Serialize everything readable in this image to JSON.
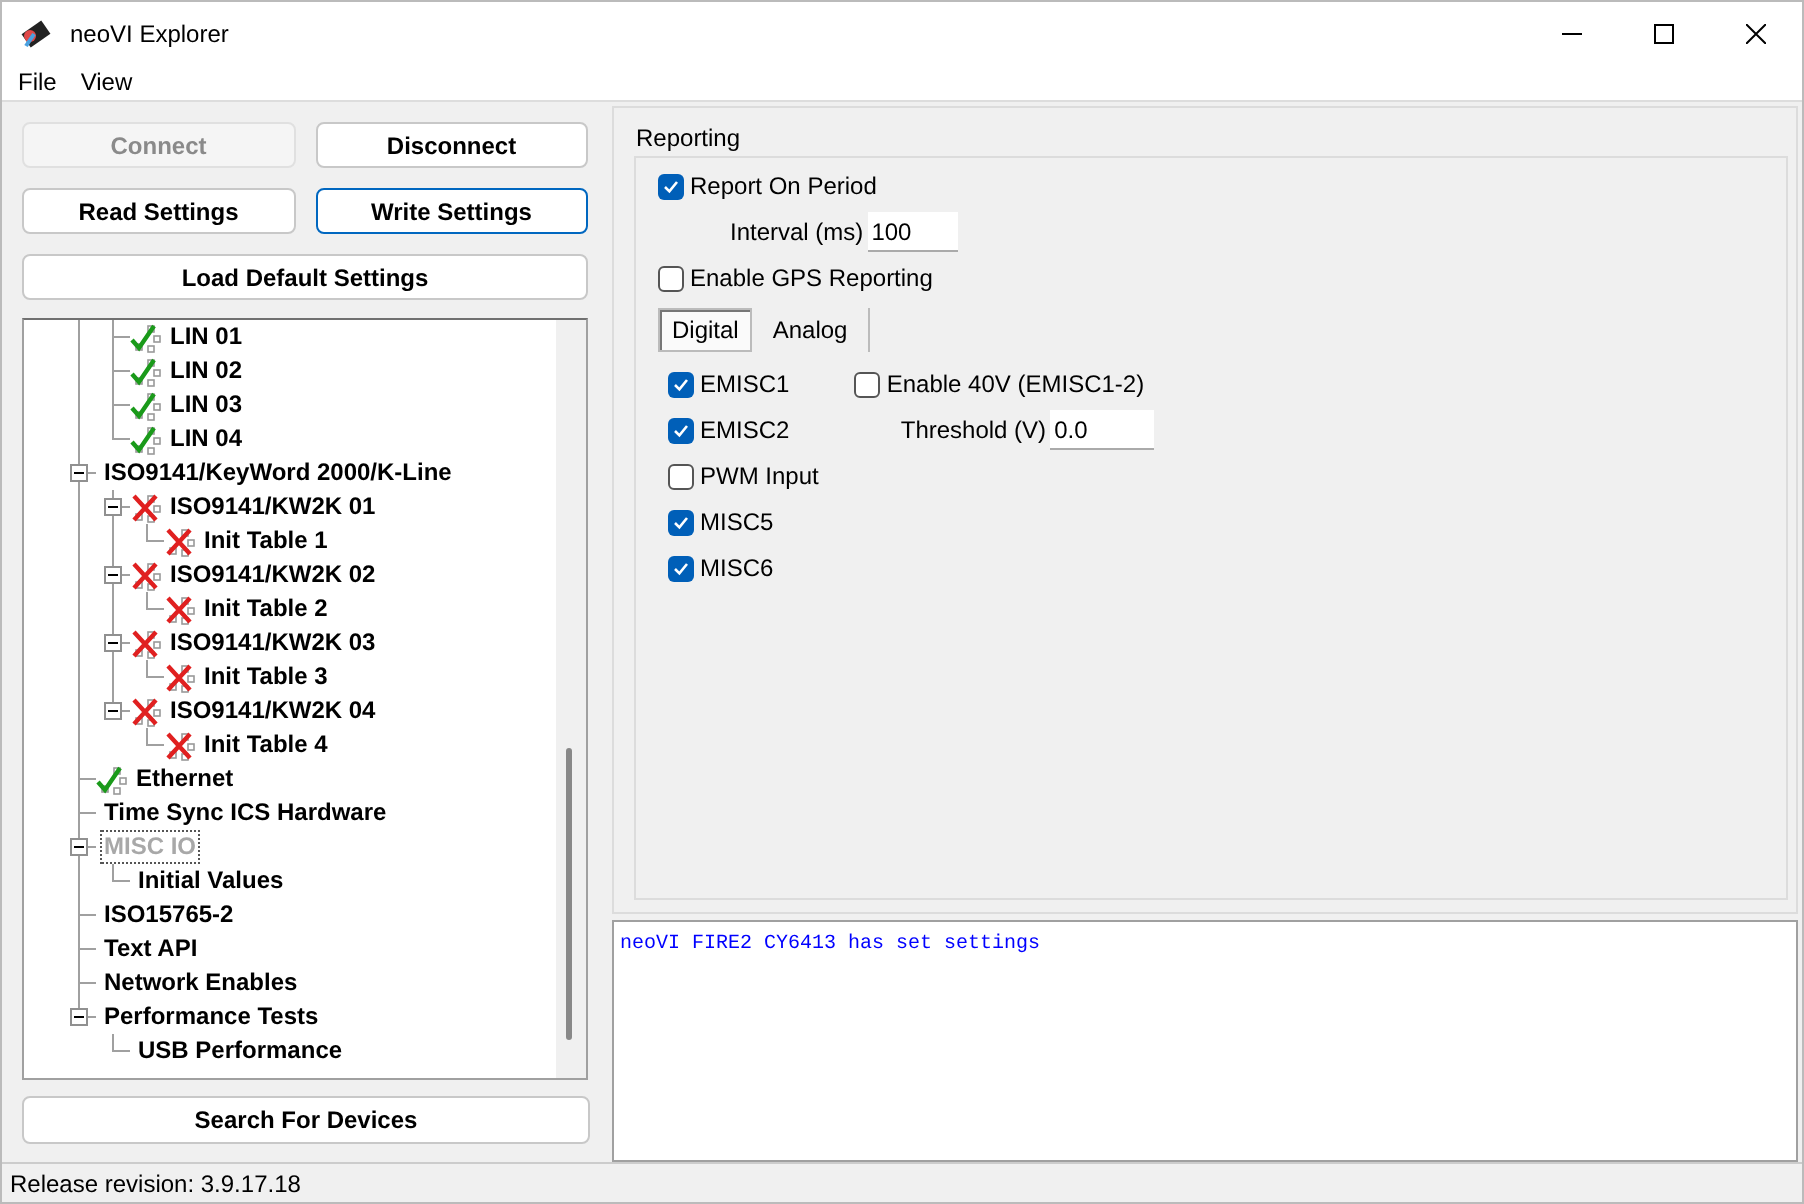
{
  "window": {
    "title": "neoVI Explorer"
  },
  "menu": [
    "File",
    "View"
  ],
  "buttons": [
    {
      "label": "Connect",
      "disabled": true,
      "focused": false
    },
    {
      "label": "Disconnect",
      "disabled": false,
      "focused": false
    },
    {
      "label": "Read Settings",
      "disabled": false,
      "focused": false
    },
    {
      "label": "Write Settings",
      "disabled": false,
      "focused": true
    },
    {
      "label": "Load Default Settings",
      "disabled": false,
      "focused": false
    }
  ],
  "tree": [
    {
      "children": [
        {
          "label": "LIN 01",
          "kind": "ok"
        },
        {
          "label": "LIN 02",
          "kind": "ok"
        },
        {
          "label": "LIN 03",
          "kind": "ok"
        },
        {
          "label": "LIN 04",
          "kind": "ok"
        }
      ]
    },
    {
      "label": "ISO9141/KeyWord 2000/K-Line",
      "expanded": true,
      "children": [
        {
          "label": "ISO9141/KW2K 01",
          "kind": "error",
          "expanded": true,
          "children": [
            {
              "label": "Init Table 1",
              "kind": "error"
            }
          ]
        },
        {
          "label": "ISO9141/KW2K 02",
          "kind": "error",
          "expanded": true,
          "children": [
            {
              "label": "Init Table 2",
              "kind": "error"
            }
          ]
        },
        {
          "label": "ISO9141/KW2K 03",
          "kind": "error",
          "expanded": true,
          "children": [
            {
              "label": "Init Table 3",
              "kind": "error"
            }
          ]
        },
        {
          "label": "ISO9141/KW2K 04",
          "kind": "error",
          "expanded": true,
          "children": [
            {
              "label": "Init Table 4",
              "kind": "error"
            }
          ]
        }
      ]
    },
    {
      "label": "Ethernet",
      "kind": "ok"
    },
    {
      "label": "Time Sync ICS Hardware"
    },
    {
      "label": "MISC IO",
      "disabled": true,
      "selected": true,
      "expanded": true,
      "children": [
        {
          "label": "Initial Values"
        }
      ]
    },
    {
      "label": "ISO15765-2"
    },
    {
      "label": "Text API"
    },
    {
      "label": "Network Enables"
    },
    {
      "label": "Performance Tests",
      "expanded": true,
      "children": [
        {
          "label": "USB Performance"
        }
      ]
    }
  ],
  "search_button": {
    "label": "Search For Devices"
  },
  "reporting": {
    "title": "Reporting",
    "report_on_period": {
      "label": "Report On Period",
      "checked": true
    },
    "interval": {
      "label": "Interval (ms)",
      "value": "100"
    },
    "gps": {
      "label": "Enable GPS Reporting",
      "checked": false
    },
    "tabs": [
      {
        "label": "Digital",
        "selected": true
      },
      {
        "label": "Analog",
        "selected": false
      }
    ],
    "digital_inputs": [
      {
        "label": "EMISC1",
        "checked": true
      },
      {
        "label": "EMISC2",
        "checked": true
      },
      {
        "label": "PWM Input",
        "checked": false
      },
      {
        "label": "MISC5",
        "checked": true
      },
      {
        "label": "MISC6",
        "checked": true
      }
    ],
    "enable_40v": {
      "label": "Enable 40V (EMISC1-2)",
      "checked": false
    },
    "threshold": {
      "label": "Threshold (V)",
      "value": "0.0"
    }
  },
  "log": [
    "neoVI FIRE2 CY6413 has set settings"
  ],
  "status_bar": "Release revision: 3.9.17.18"
}
